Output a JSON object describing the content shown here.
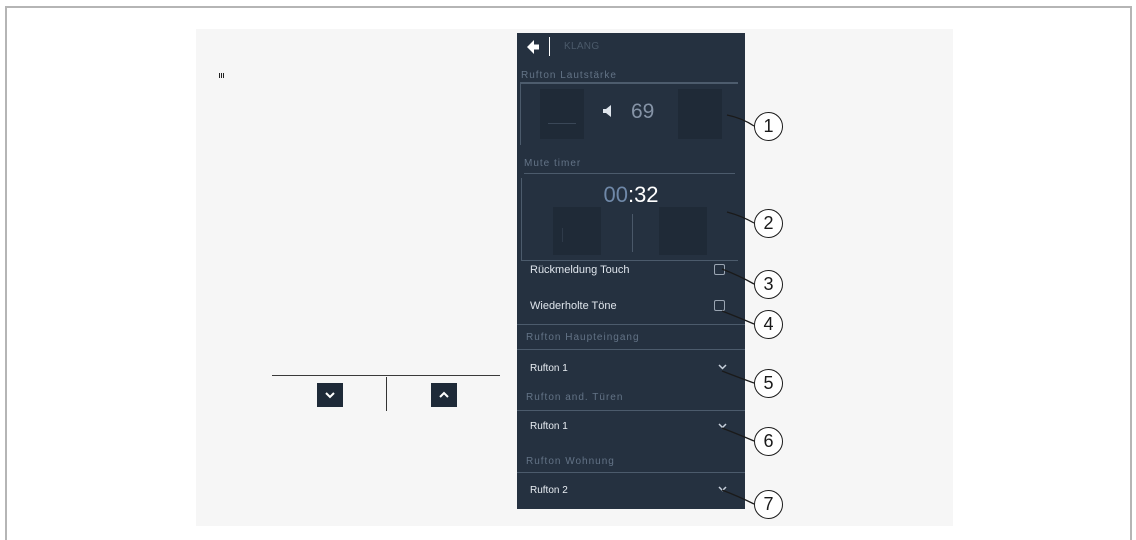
{
  "panel": {
    "title": "KLANG",
    "volume": {
      "label": "Rufton Lautstärke",
      "value": "69"
    },
    "mute_timer": {
      "label": "Mute timer",
      "minutes": "00",
      "separator": ":",
      "seconds": "32"
    },
    "toggles": [
      {
        "label": "Rückmeldung Touch",
        "checked": false
      },
      {
        "label": "Wiederholte Töne",
        "checked": false
      }
    ],
    "dropdowns": [
      {
        "label": "Rufton Haupteingang",
        "value": "Rufton 1"
      },
      {
        "label": "Rufton and. Türen",
        "value": "Rufton 1"
      },
      {
        "label": "Rufton Wohnung",
        "value": "Rufton 2"
      }
    ]
  },
  "callouts": [
    "1",
    "2",
    "3",
    "4",
    "5",
    "6",
    "7"
  ],
  "colors": {
    "panel_bg": "#253140",
    "button_bg": "#1f2a37",
    "timer_minutes": "#6f88a8",
    "muted_text": "#637386"
  }
}
